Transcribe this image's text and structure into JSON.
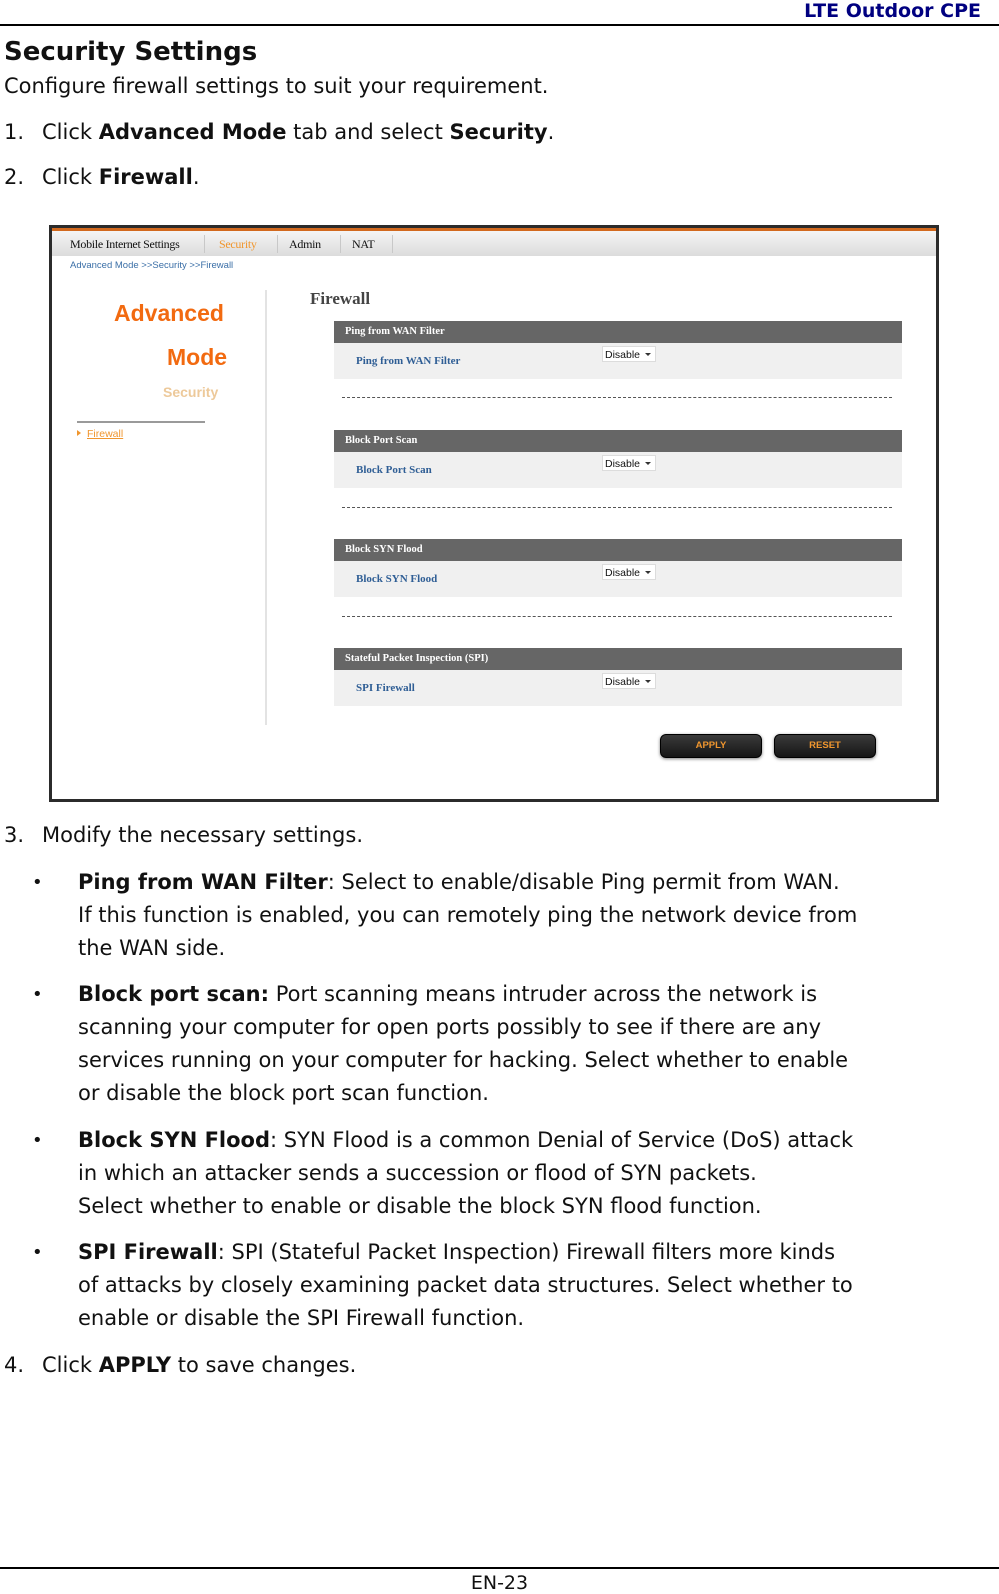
{
  "running_header": "LTE Outdoor CPE",
  "title": "Security Settings",
  "intro": "Configure firewall settings to suit your requirement.",
  "steps": [
    {
      "num": "1.",
      "pre": "Click ",
      "b1": "Advanced Mode",
      "mid": " tab and select ",
      "b2": "Security",
      "post": "."
    },
    {
      "num": "2.",
      "pre": "Click ",
      "b1": "Firewall",
      "post": "."
    },
    {
      "num": "3.",
      "text": "Modify the necessary settings."
    },
    {
      "num": "4.",
      "pre": "Click ",
      "b1": "APPLY",
      "post": " to save changes."
    }
  ],
  "screenshot": {
    "tabs": [
      "Mobile Internet Settings",
      "Security",
      "Admin",
      "NAT"
    ],
    "active_tab": "Security",
    "breadcrumb": "Advanced Mode >>Security >>Firewall",
    "sidebar": {
      "title_line1": "Advanced",
      "title_line2": "Mode",
      "subtitle": "Security",
      "links": [
        "Firewall"
      ]
    },
    "page_title": "Firewall",
    "sections": [
      {
        "header": "Ping from WAN Filter",
        "label": "Ping from WAN Filter",
        "value": "Disable"
      },
      {
        "header": "Block Port Scan",
        "label": "Block Port Scan",
        "value": "Disable"
      },
      {
        "header": "Block SYN Flood",
        "label": "Block SYN Flood",
        "value": "Disable"
      },
      {
        "header": "Stateful Packet Inspection (SPI)",
        "label": "SPI Firewall",
        "value": "Disable"
      }
    ],
    "buttons": {
      "apply": "APPLY",
      "reset": "RESET"
    }
  },
  "bullets": [
    {
      "term": "Ping from WAN Filter",
      "sep": ": ",
      "lines": [
        "Select to enable/disable Ping permit from WAN.",
        "If this function is enabled, you can remotely ping the network device from",
        "the WAN side."
      ]
    },
    {
      "term": "Block port scan:",
      "sep": " ",
      "lines": [
        "Port scanning means intruder across the network is",
        "scanning your computer for open ports possibly to see if there are any",
        "services running on your computer for hacking. Select whether to enable",
        "or disable the block port scan function."
      ]
    },
    {
      "term": "Block SYN Flood",
      "sep": ": ",
      "lines": [
        "SYN Flood is a common Denial of Service (DoS) attack",
        "in which an attacker sends a succession or flood of SYN packets.",
        "Select whether to enable or disable the block SYN flood function."
      ]
    },
    {
      "term": "SPI Firewall",
      "sep": ": ",
      "lines": [
        "SPI (Stateful Packet Inspection) Firewall filters more kinds",
        "of attacks by closely examining packet data structures. Select whether to",
        "enable or disable the SPI Firewall function."
      ]
    }
  ],
  "page_number": "EN-23"
}
